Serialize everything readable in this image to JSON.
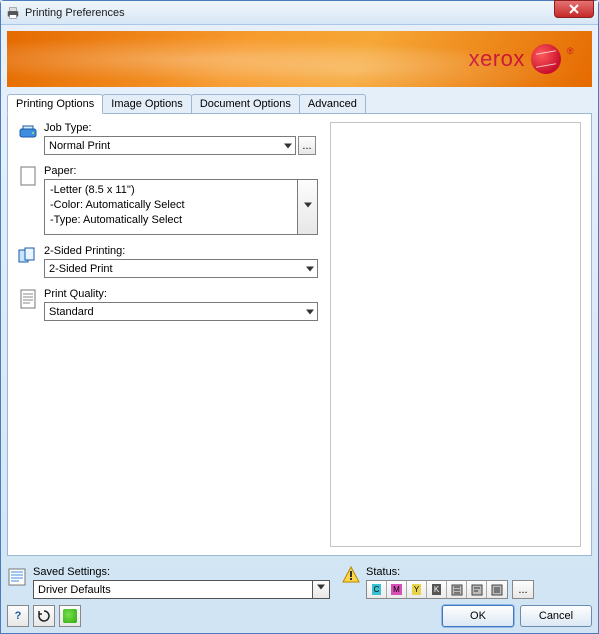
{
  "window": {
    "title": "Printing Preferences"
  },
  "brand": {
    "name": "xerox"
  },
  "tabs": {
    "printing_options": "Printing Options",
    "image_options": "Image Options",
    "document_options": "Document Options",
    "advanced": "Advanced",
    "active": "printing_options"
  },
  "fields": {
    "job_type": {
      "label": "Job Type:",
      "value": "Normal Print"
    },
    "paper": {
      "label": "Paper:",
      "lines": {
        "size": "-Letter (8.5 x 11'')",
        "color": "-Color: Automatically Select",
        "type": "-Type: Automatically Select"
      }
    },
    "two_sided": {
      "label": "2-Sided Printing:",
      "value": "2-Sided Print"
    },
    "print_quality": {
      "label": "Print Quality:",
      "value": "Standard"
    }
  },
  "saved_settings": {
    "label": "Saved Settings:",
    "value": "Driver Defaults"
  },
  "status": {
    "label": "Status:",
    "toner_letters": {
      "c": "C",
      "m": "M",
      "y": "Y",
      "k": "K"
    }
  },
  "buttons": {
    "ok": "OK",
    "cancel": "Cancel",
    "help": "?",
    "ellipsis": "..."
  }
}
